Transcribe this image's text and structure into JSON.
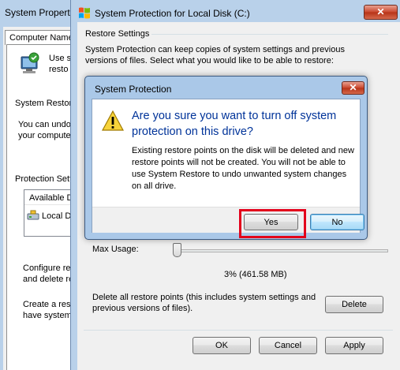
{
  "system_properties": {
    "title": "System Properties",
    "tab_label": "Computer Name",
    "use_text_line1": "Use s",
    "use_text_line2": "resto",
    "system_restore_label": "System Restore",
    "can_undo_line1": "You can undo",
    "can_undo_line2": "your computer",
    "protection_settings_label": "Protection Setti",
    "available_drives_header": "Available D",
    "local_disk_item": "Local D",
    "configure_line1": "Configure res",
    "configure_line2": "and delete res",
    "create_line1": "Create a rest",
    "create_line2": "have system"
  },
  "protection_window": {
    "title": "System Protection for Local Disk (C:)",
    "close_glyph": "✕",
    "restore_settings_label": "Restore Settings",
    "restore_settings_text": "System Protection can keep copies of system settings and previous versions of files. Select what you would like to be able to restore:",
    "max_usage_label": "Max Usage:",
    "usage_value": "3% (461.58 MB)",
    "delete_text": "Delete all restore points (this includes system settings and previous versions of files).",
    "delete_button": "Delete",
    "ok_button": "OK",
    "cancel_button": "Cancel",
    "apply_button": "Apply"
  },
  "confirm_dialog": {
    "title": "System Protection",
    "close_glyph": "✕",
    "instruction": "Are you sure you want to turn off system protection on this drive?",
    "body": "Existing restore points on the disk will be deleted and new restore points will not be created. You will not be able to use System Restore to undo unwanted system changes on all drive.",
    "yes_button": "Yes",
    "no_button": "No"
  },
  "colors": {
    "instruction_text": "#003399",
    "highlight_box": "#e3001b",
    "title_bar": "#b9d1ea"
  }
}
